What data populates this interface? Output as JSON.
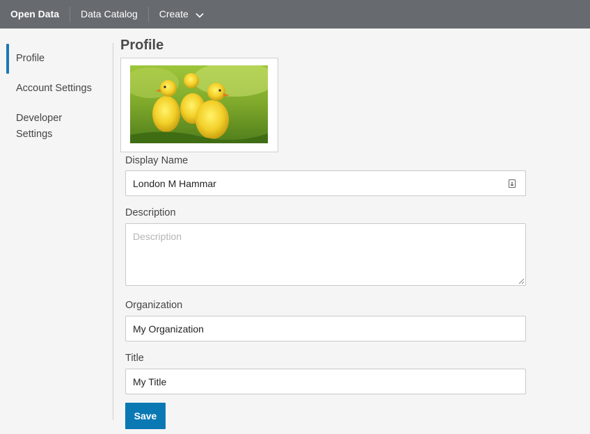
{
  "nav": {
    "brand": "Open Data",
    "items": [
      "Data Catalog",
      "Create"
    ]
  },
  "sidebar": {
    "items": [
      {
        "label": "Profile",
        "active": true
      },
      {
        "label": "Account Settings",
        "active": false
      },
      {
        "label": "Developer Settings",
        "active": false
      }
    ]
  },
  "profile": {
    "title": "Profile",
    "avatar_alt": "ducklings photo",
    "display_name_label": "Display Name",
    "display_name_value": "London M Hammar",
    "description_label": "Description",
    "description_placeholder": "Description",
    "description_value": "",
    "organization_label": "Organization",
    "organization_value": "My Organization",
    "title_label": "Title",
    "title_value": "My Title",
    "save_label": "Save"
  },
  "colors": {
    "topbar": "#676b70",
    "accent": "#0a79b3",
    "active_indicator": "#1b78b4"
  },
  "icons": {
    "create_dropdown": "chevron-down-icon",
    "display_name_field": "contact-card-icon",
    "textarea_resize": "resize-grip-icon"
  }
}
